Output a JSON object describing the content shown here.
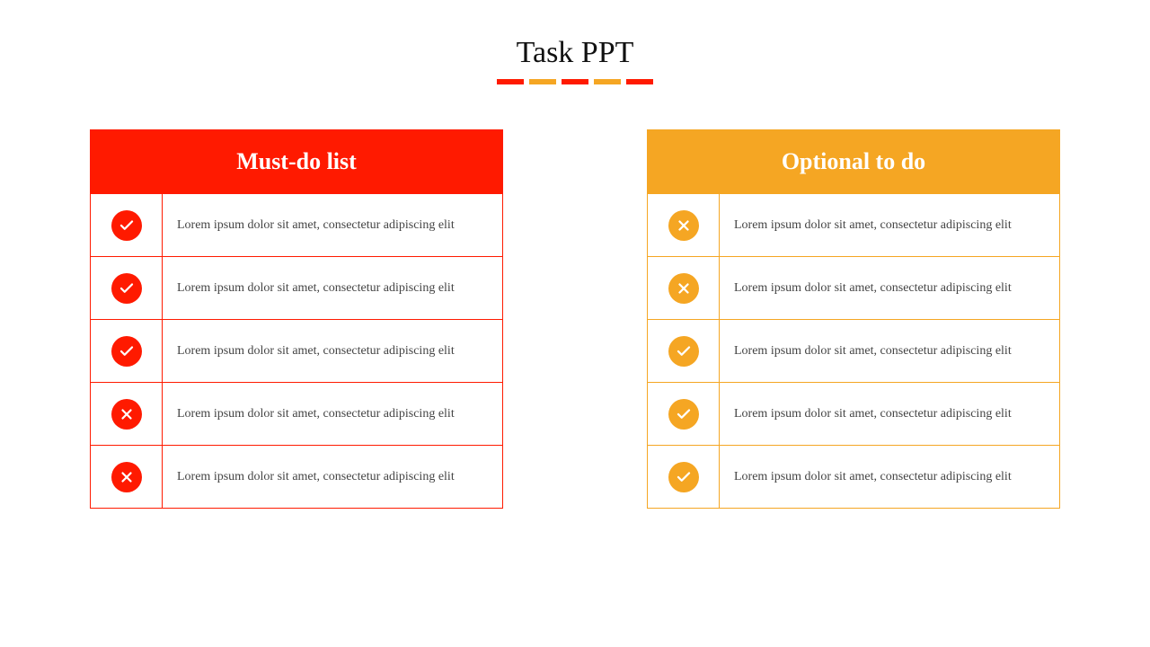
{
  "title": "Task PPT",
  "colors": {
    "red": "#ff1a00",
    "orange": "#f5a623"
  },
  "dashes": [
    "red",
    "orange",
    "red",
    "orange",
    "red"
  ],
  "left": {
    "header": "Must-do list",
    "items": [
      {
        "icon": "check",
        "text": "Lorem ipsum dolor sit amet, consectetur adipiscing elit"
      },
      {
        "icon": "check",
        "text": "Lorem ipsum dolor sit amet, consectetur adipiscing elit"
      },
      {
        "icon": "check",
        "text": "Lorem ipsum dolor sit amet, consectetur adipiscing elit"
      },
      {
        "icon": "cross",
        "text": "Lorem ipsum dolor sit amet, consectetur adipiscing elit"
      },
      {
        "icon": "cross",
        "text": "Lorem ipsum dolor sit amet, consectetur adipiscing elit"
      }
    ]
  },
  "right": {
    "header": "Optional to do",
    "items": [
      {
        "icon": "cross",
        "text": "Lorem ipsum dolor sit amet, consectetur adipiscing elit"
      },
      {
        "icon": "cross",
        "text": "Lorem ipsum dolor sit amet, consectetur adipiscing elit"
      },
      {
        "icon": "check",
        "text": "Lorem ipsum dolor sit amet, consectetur adipiscing elit"
      },
      {
        "icon": "check",
        "text": "Lorem ipsum dolor sit amet, consectetur adipiscing elit"
      },
      {
        "icon": "check",
        "text": "Lorem ipsum dolor sit amet, consectetur adipiscing elit"
      }
    ]
  }
}
